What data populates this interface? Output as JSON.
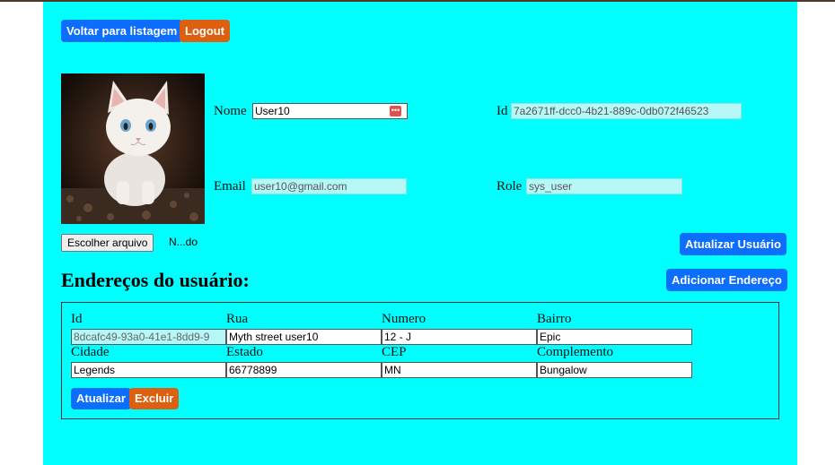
{
  "header": {
    "back_label": "Voltar para listagem",
    "logout_label": "Logout"
  },
  "user": {
    "nome_label": "Nome",
    "nome_value": "User10",
    "id_label": "Id",
    "id_value": "7a2671ff-dcc0-4b21-889c-0db072f46523",
    "email_label": "Email",
    "email_value": "user10@gmail.com",
    "role_label": "Role",
    "role_value": "sys_user",
    "file_button_label": "Escolher arquivo",
    "file_name": "N...do",
    "update_label": "Atualizar Usuário"
  },
  "addresses": {
    "title": "Endereços do usuário:",
    "add_label": "Adicionar Endereço",
    "items": [
      {
        "id_label": "Id",
        "id_value": "8dcafc49-93a0-41e1-8dd9-9",
        "rua_label": "Rua",
        "rua_value": "Myth street user10",
        "numero_label": "Numero",
        "numero_value": "12 - J",
        "bairro_label": "Bairro",
        "bairro_value": "Epic",
        "cidade_label": "Cidade",
        "cidade_value": "Legends",
        "estado_label": "Estado",
        "estado_value": "66778899",
        "cep_label": "CEP",
        "cep_value": "MN",
        "complemento_label": "Complemento",
        "complemento_value": "Bungalow",
        "update_label": "Atualizar",
        "delete_label": "Excluir"
      }
    ]
  },
  "colors": {
    "panel_bg": "#00ffff",
    "primary": "#0d6efd",
    "danger": "#dc6010",
    "readonly_bg": "#b6f7f7"
  }
}
